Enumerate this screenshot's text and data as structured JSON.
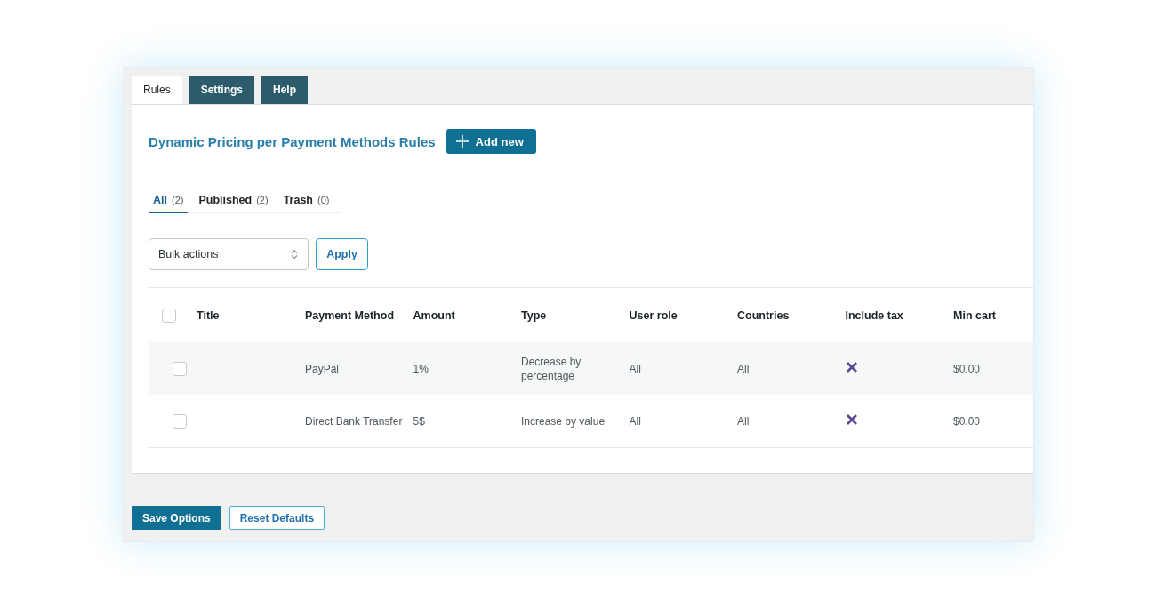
{
  "tabs": [
    {
      "label": "Rules",
      "selected": true
    },
    {
      "label": "Settings",
      "selected": false
    },
    {
      "label": "Help",
      "selected": false
    }
  ],
  "heading": "Dynamic Pricing per Payment Methods Rules",
  "add_button": "Add new",
  "filters": [
    {
      "label": "All",
      "count": "(2)",
      "selected": true
    },
    {
      "label": "Published",
      "count": "(2)",
      "selected": false
    },
    {
      "label": "Trash",
      "count": "(0)",
      "selected": false
    }
  ],
  "bulk_actions": {
    "value": "Bulk actions"
  },
  "apply_button": "Apply",
  "table": {
    "select_all_checked": false,
    "columns": [
      "Title",
      "Payment Method",
      "Amount",
      "Type",
      "User role",
      "Countries",
      "Include tax",
      "Min cart"
    ],
    "rows": [
      {
        "checked": false,
        "title": "",
        "payment_method": "PayPal",
        "amount": "1%",
        "type": "Decrease by percentage",
        "user_role": "All",
        "countries": "All",
        "include_tax": false,
        "min_cart": "$0.00"
      },
      {
        "checked": false,
        "title": "",
        "payment_method": "Direct Bank Transfer",
        "amount": "5$",
        "type": "Increase by value",
        "user_role": "All",
        "countries": "All",
        "include_tax": false,
        "min_cart": "$0.00"
      }
    ]
  },
  "buttons": [
    {
      "label": "Save Options",
      "kind": "primary"
    },
    {
      "label": "Reset Defaults",
      "kind": "secondary"
    }
  ]
}
